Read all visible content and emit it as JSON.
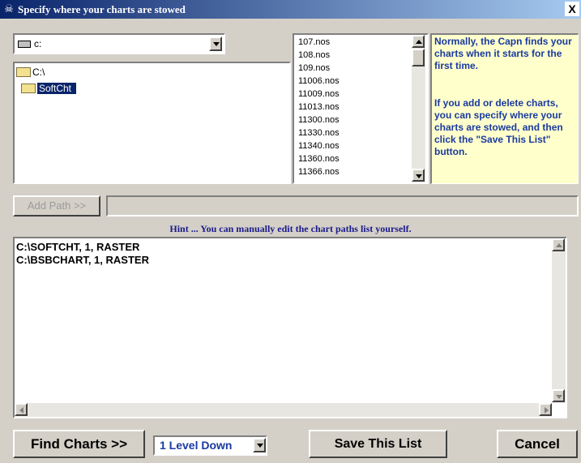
{
  "window": {
    "title": "Specify where your charts are stowed",
    "close_label": "X"
  },
  "drive": {
    "value": "c:"
  },
  "tree": [
    {
      "label": "C:\\",
      "selected": false
    },
    {
      "label": "SoftCht",
      "selected": true
    }
  ],
  "files": [
    "107.nos",
    "108.nos",
    "109.nos",
    "11006.nos",
    "11009.nos",
    "11013.nos",
    "11300.nos",
    "11330.nos",
    "11340.nos",
    "11360.nos",
    "11366.nos"
  ],
  "info": {
    "para1": "Normally, the Capn finds your charts when it starts for the first time.",
    "para2": "If you add or delete charts, you can specify where your charts are stowed, and then click the \"Save This List\" button."
  },
  "add_path": {
    "label": "Add Path >>"
  },
  "path_field": {
    "value": ""
  },
  "hint": "Hint ... You can manually edit the chart paths list yourself.",
  "chart_paths": [
    "C:\\SOFTCHT, 1, RASTER",
    "C:\\BSBCHART, 1, RASTER"
  ],
  "buttons": {
    "find": "Find Charts >>",
    "save": "Save This List",
    "cancel": "Cancel"
  },
  "level_select": {
    "value": "1 Level Down"
  },
  "colors": {
    "title_start": "#0a246a",
    "title_end": "#a6caf0",
    "info_bg": "#ffffcc",
    "info_text": "#1a3aa0",
    "hint_text": "#1a1a8a"
  }
}
